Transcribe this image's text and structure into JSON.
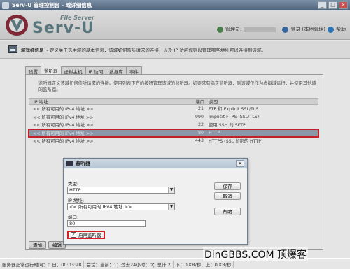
{
  "window": {
    "title": "Serv-U 管理控制台 - 域详细信息",
    "controls": [
      "_",
      "□",
      "×"
    ]
  },
  "header": {
    "logo_small": "File Server",
    "logo_big": "Serv-U",
    "admin_label": "管理员:",
    "logout_label": "登录 (本地管理)",
    "help_label": "帮助"
  },
  "page": {
    "title": "域详细信息",
    "description": "- 定义关于选中域的基本信息，该域如何监听请求的连接，以及 IP 访问规则以管理哪些地址可以连接到该域。"
  },
  "tabs": [
    "设置",
    "监听器",
    "虚拟主机",
    "IP 访问",
    "数据库",
    "事件"
  ],
  "active_tab": 1,
  "panel": {
    "description": "监听器定义该域如何侦听请求的连接。使用列表下方的按钮管理该域的监听器。如要求有指定监听器，则该域仅作为虚拟域运行，并使用其他域的监听器。",
    "columns": {
      "ip": "IP 地址",
      "port": "端口",
      "type": "类型"
    },
    "rows": [
      {
        "ip": "<< 所有可用的 IPv4 地址 >>",
        "port": "21",
        "type": "FTP 和 Explicit SSL/TLS"
      },
      {
        "ip": "<< 所有可用的 IPv4 地址 >>",
        "port": "990",
        "type": "Implicit FTPS (SSL/TLS)"
      },
      {
        "ip": "<< 所有可用的 IPv4 地址 >>",
        "port": "22",
        "type": "使用 SSH 的 SFTP"
      },
      {
        "ip": "<< 所有可用的 IPv4 地址 >>",
        "port": "80",
        "type": "HTTP"
      },
      {
        "ip": "<< 所有可用的 IPv4 地址 >>",
        "port": "443",
        "type": "HTTPS (SSL 加密的 HTTP)"
      }
    ],
    "buttons": {
      "add": "添加",
      "edit": "编辑"
    }
  },
  "dialog": {
    "title": "监听器",
    "type_label": "类型:",
    "type_value": "HTTP",
    "ip_label": "IP 地址:",
    "ip_value": "<< 所有可用的 IPv4 地址 >>",
    "port_label": "端口:",
    "port_value": "80",
    "enable_label": "启用监听器",
    "enable_checked": true,
    "save": "保存",
    "cancel": "取消",
    "help": "帮助"
  },
  "status": {
    "running": "服务器正常运行时间：0 日，00:03:28",
    "sessions": "会话：当前：1；过去24小时：0；总计 2",
    "traffic": "下：0 KB/秒，上：0 KB/秒"
  },
  "watermark": "DinGBBS.COM 顶爆客"
}
